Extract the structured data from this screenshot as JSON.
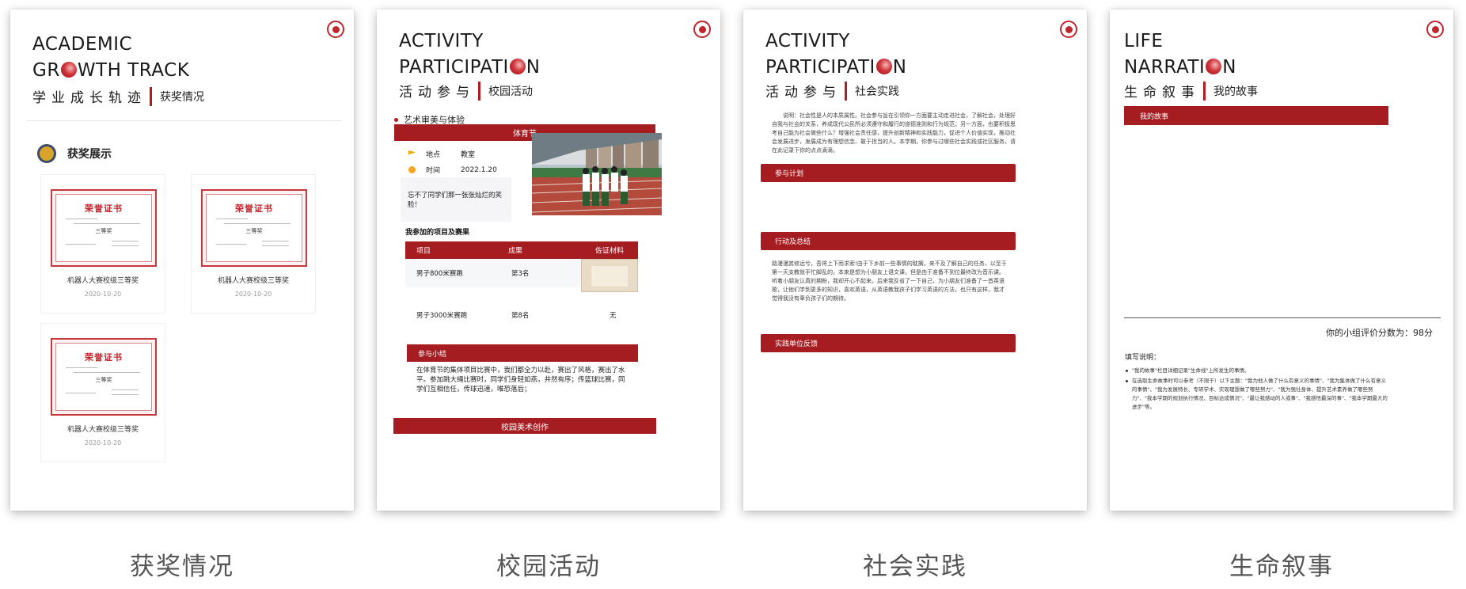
{
  "colors": {
    "accent": "#a51c21",
    "caption": "#555555"
  },
  "pages": [
    {
      "caption": "获奖情况",
      "title_line1": "ACADEMIC",
      "title_line2_pre": "GR",
      "title_line2_post": "WTH TRACK",
      "subtitle_cn": "学业成长轨迹",
      "subtitle_tag": "获奖情况",
      "section_title": "获奖展示",
      "cards": [
        {
          "cert_title": "荣誉证书",
          "grade": "三等奖",
          "label": "机器人大赛校级三等奖",
          "date": "2020-10-20"
        },
        {
          "cert_title": "荣誉证书",
          "grade": "三等奖",
          "label": "机器人大赛校级三等奖",
          "date": "2020-10-20"
        },
        {
          "cert_title": "荣誉证书",
          "grade": "三等奖",
          "label": "机器人大赛校级三等奖",
          "date": "2020-10-20"
        }
      ]
    },
    {
      "caption": "校园活动",
      "title_line1": "ACTIVITY",
      "title_line2_pre": "PARTICIPATI",
      "title_line2_post": "N",
      "subtitle_cn": "活动参与",
      "subtitle_tag": "校园活动",
      "bullet": "艺术审美与体验",
      "event_bar": "体育节",
      "place_key": "地点",
      "place_val": "教室",
      "time_key": "时间",
      "time_val": "2022.1.20",
      "quote": "忘不了同学们那一张张灿烂的笑脸！",
      "projects_title": "我参加的项目及赛果",
      "table_head": [
        "项目",
        "成果",
        "佐证材料"
      ],
      "rows": [
        {
          "item": "男子800米赛跑",
          "result": "第3名",
          "proof": ""
        },
        {
          "item": "男子3000米赛跑",
          "result": "第8名",
          "proof": "无"
        }
      ],
      "summary_bar": "参与小结",
      "summary_text": "在体育节的集体项目比赛中，我们都全力以赴，赛出了风格，赛出了水平。参加跳大绳比赛时，同学们身轻如燕，井然有序；传篮球比赛，同学们互相信任，传球迅速，唯恐落后；",
      "bottom_bar": "校园美术创作"
    },
    {
      "caption": "社会实践",
      "title_line1": "ACTIVITY",
      "title_line2_pre": "PARTICIPATI",
      "title_line2_post": "N",
      "subtitle_cn": "活动参与",
      "subtitle_tag": "社会实践",
      "intro": "说明：社会性是人的本质属性。社会参与旨在引领你一方面要主动走进社会，了解社会，处理好自我与社会的关系，养成现代公民所必须遵守和履行的道德准则和行为规范；另一方面，也要积极思考自己能为社会做些什么？增强社会责任感，提升创新精神和实践能力，促进个人价值实现，推动社会发展进步，发展成为有理想信念、敢于担当的人。本学期，你参与过哪些社会实践或社区服务，请在此记录下你的点点滴滴。",
      "bar1": "参与计划",
      "bar2": "行动及总结",
      "summary": "路漫漫其修远兮，吾将上下而求索!由于下乡前一些事情的耽搁，来不及了解自己的任务，以至于第一天支教就手忙脚乱的。本来是想为小朋友上语文课，但是由于准备不到位最终改为音乐课。听着小朋友认真的期盼，我却开心不起来。后来我反省了一下自己，为小朋友们准备了一首英语歌，让他们学到更多的知识，喜欢英语，从英语教我孩子们学习英语的方法，也只有这样，我才觉得我没有辜负孩子们的期待。",
      "bar3": "实践单位反馈"
    },
    {
      "caption": "生命叙事",
      "title_line1": "LIFE",
      "title_line2_pre": "NARRATI",
      "title_line2_post": "N",
      "subtitle_cn": "生命叙事",
      "subtitle_tag": "我的故事",
      "story_bar": "我的故事",
      "score": "你的小组评价分数为：98分",
      "hint_title": "填写说明：",
      "hint1": "\"我的故事\"栏目详细记录\"生命线\"上所发生的事情。",
      "hint2": "在选取生命故事时可以参考（不限于）以下主题：\"我为他人做了什么有意义的事情\"、\"我为集体做了什么有意义的事情\"、\"我为发展特长、专研学术、实现理想做了哪些努力\"、\"我为强壮身体、提升艺术素养做了哪些努力\"、\"我本学期的规划执行情况、目标达成情况\"、\"最让我感动的人或事\"、\"我感悟最深的事\"、\"我本学期最大的进步\"等。"
    }
  ]
}
